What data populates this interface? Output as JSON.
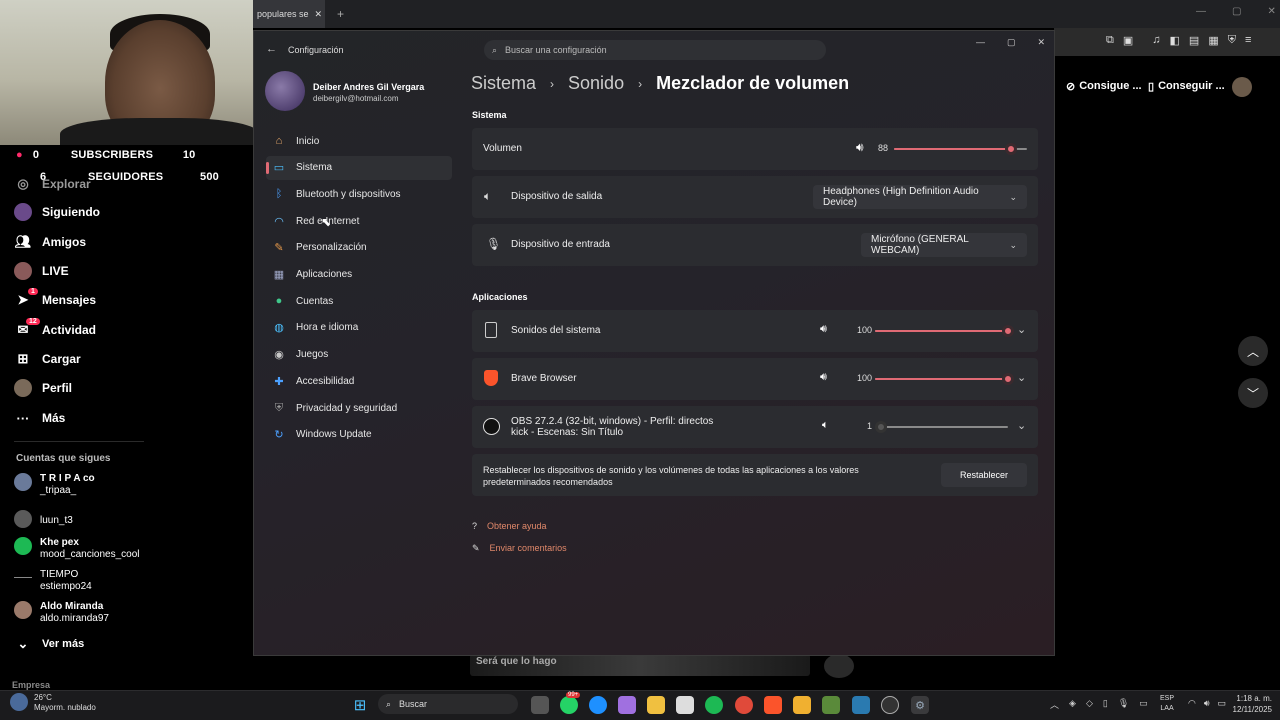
{
  "tiktok": {
    "stats": [
      {
        "num": "0",
        "label": "SUBSCRIBERS",
        "value": "10"
      },
      {
        "num": "6",
        "label": "SEGUIDORES",
        "value": "500"
      }
    ],
    "nav": [
      "Explorar",
      "Siguiendo",
      "Amigos",
      "LIVE",
      "Mensajes",
      "Actividad",
      "Cargar",
      "Perfil",
      "Más"
    ],
    "badge_messages": "1",
    "badge_activity": "12",
    "following_header": "Cuentas que sigues",
    "following": [
      {
        "name": "T R I P A co",
        "handle": "_tripaa_"
      },
      {
        "name": "luun_t3",
        "handle": ""
      },
      {
        "name": "Khe pex",
        "handle": "mood_canciones_cool"
      },
      {
        "name": "TIEMPO",
        "handle": "estiempo24"
      },
      {
        "name": "Aldo Miranda",
        "handle": "aldo.miranda97"
      }
    ],
    "see_more": "Ver más",
    "company": "Empresa",
    "bottom_search": "Será que lo hago"
  },
  "browser": {
    "tab_title": "populares se",
    "pill1": "Consigue ...",
    "pill2": "Conseguir ..."
  },
  "settings": {
    "app_title": "Configuración",
    "search_placeholder": "Buscar una configuración",
    "user_name": "Deiber Andres Gil Vergara",
    "user_email": "deibergilv@hotmail.com",
    "sidebar": [
      {
        "label": "Inicio",
        "icon": "home-icon",
        "color": "#e8a76a"
      },
      {
        "label": "Sistema",
        "icon": "monitor-icon",
        "color": "#4cc2ff"
      },
      {
        "label": "Bluetooth y dispositivos",
        "icon": "bluetooth-icon",
        "color": "#4ca0ff"
      },
      {
        "label": "Red e Internet",
        "icon": "wifi-icon",
        "color": "#6cc4ff"
      },
      {
        "label": "Personalización",
        "icon": "brush-icon",
        "color": "#e89a4a"
      },
      {
        "label": "Aplicaciones",
        "icon": "apps-icon",
        "color": "#a0a8c8"
      },
      {
        "label": "Cuentas",
        "icon": "person-icon",
        "color": "#3fc78a"
      },
      {
        "label": "Hora e idioma",
        "icon": "globe-icon",
        "color": "#4cc2ff"
      },
      {
        "label": "Juegos",
        "icon": "gamepad-icon",
        "color": "#c8c8c8"
      },
      {
        "label": "Accesibilidad",
        "icon": "accessibility-icon",
        "color": "#4ca0ff"
      },
      {
        "label": "Privacidad y seguridad",
        "icon": "shield-icon",
        "color": "#9a9a9a"
      },
      {
        "label": "Windows Update",
        "icon": "update-icon",
        "color": "#4ca0ff"
      }
    ],
    "breadcrumb": [
      "Sistema",
      "Sonido",
      "Mezclador de volumen"
    ],
    "section_system": "Sistema",
    "volume_label": "Volumen",
    "volume_value": "88",
    "volume_level": 0.88,
    "output_label": "Dispositivo de salida",
    "output_value": "Headphones (High Definition Audio Device)",
    "input_label": "Dispositivo de entrada",
    "input_value": "Micrófono (GENERAL WEBCAM)",
    "section_apps": "Aplicaciones",
    "apps": [
      {
        "name": "Sonidos del sistema",
        "name2": "",
        "value": "100",
        "level": 1.0
      },
      {
        "name": "Brave Browser",
        "name2": "",
        "value": "100",
        "level": 1.0
      },
      {
        "name": "OBS 27.2.4 (32-bit, windows) - Perfil: directos",
        "name2": "kick - Escenas: Sin Título",
        "value": "1",
        "level": 0.01
      }
    ],
    "reset_text_1": "Restablecer los dispositivos de sonido y los volúmenes de todas las aplicaciones a los valores",
    "reset_text_2": "predeterminados recomendados",
    "reset_button": "Restablecer",
    "help_link": "Obtener ayuda",
    "feedback_link": "Enviar comentarios",
    "accent": "#e06a74"
  },
  "taskbar": {
    "weather_temp": "26°C",
    "weather_desc": "Mayorm. nublado",
    "search": "Buscar",
    "lang1": "ESP",
    "lang2": "LAA",
    "time": "1:18 a. m.",
    "date": "12/11/2025",
    "notif_badge": "99+"
  }
}
